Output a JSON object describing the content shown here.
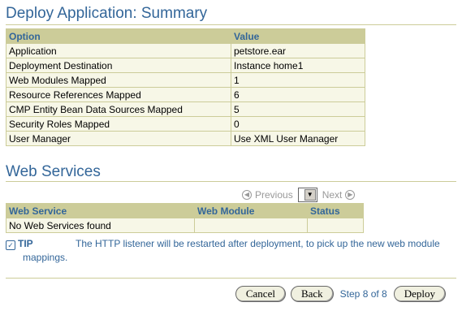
{
  "summary": {
    "heading": "Deploy Application: Summary",
    "columns": [
      "Option",
      "Value"
    ],
    "rows": [
      [
        "Application",
        "petstore.ear"
      ],
      [
        "Deployment Destination",
        "Instance home1"
      ],
      [
        "Web Modules Mapped",
        "1"
      ],
      [
        "Resource References Mapped",
        "6"
      ],
      [
        "CMP Entity Bean Data Sources Mapped",
        "5"
      ],
      [
        "Security Roles Mapped",
        "0"
      ],
      [
        "User Manager",
        "Use XML User Manager"
      ]
    ]
  },
  "web_services": {
    "heading": "Web Services",
    "nav": {
      "previous": "Previous",
      "next": "Next"
    },
    "columns": [
      "Web Service",
      "Web Module",
      "Status"
    ],
    "empty_message": "No Web Services found"
  },
  "tip": {
    "label": "TIP",
    "text": "The HTTP listener will be restarted after deployment, to pick up the new web module mappings."
  },
  "footer": {
    "cancel": "Cancel",
    "back": "Back",
    "step": "Step 8 of 8",
    "deploy": "Deploy"
  },
  "colors": {
    "heading": "#336699",
    "table_header": "#cccc99",
    "table_body": "#f7f7e7"
  }
}
